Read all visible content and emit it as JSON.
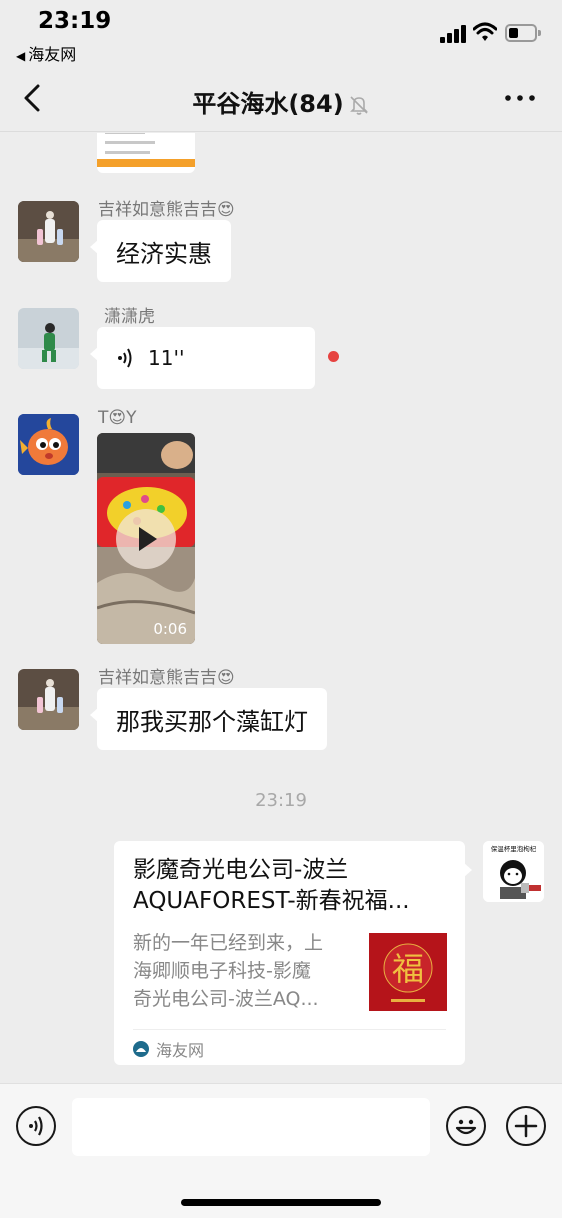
{
  "status_bar": {
    "time": "23:19",
    "back_app": "海友网"
  },
  "nav": {
    "title": "平谷海水(84)"
  },
  "messages": [
    {
      "sender": "吉祥如意熊吉吉😍",
      "text": "经济实惠"
    },
    {
      "sender": "潇潇虎",
      "voice_duration": "11''"
    },
    {
      "sender": "T😍Y",
      "video_duration": "0:06"
    },
    {
      "sender": "吉祥如意熊吉吉😍",
      "text": "那我买那个藻缸灯"
    }
  ],
  "timestamp": "23:19",
  "card": {
    "title_line1": "影魔奇光电公司-波兰",
    "title_line2": "AQUAFOREST-新春祝福...",
    "desc_line1": "新的一年已经到来，上",
    "desc_line2": "海卿顺电子科技-影魔",
    "desc_line3": "奇光电公司-波兰AQ...",
    "source": "海友网",
    "thumb_char": "福"
  },
  "self_avatar_caption": "保温杯里泡枸杞",
  "colors": {
    "background": "#ededed",
    "bubble": "#ffffff",
    "unread": "#e64340"
  }
}
